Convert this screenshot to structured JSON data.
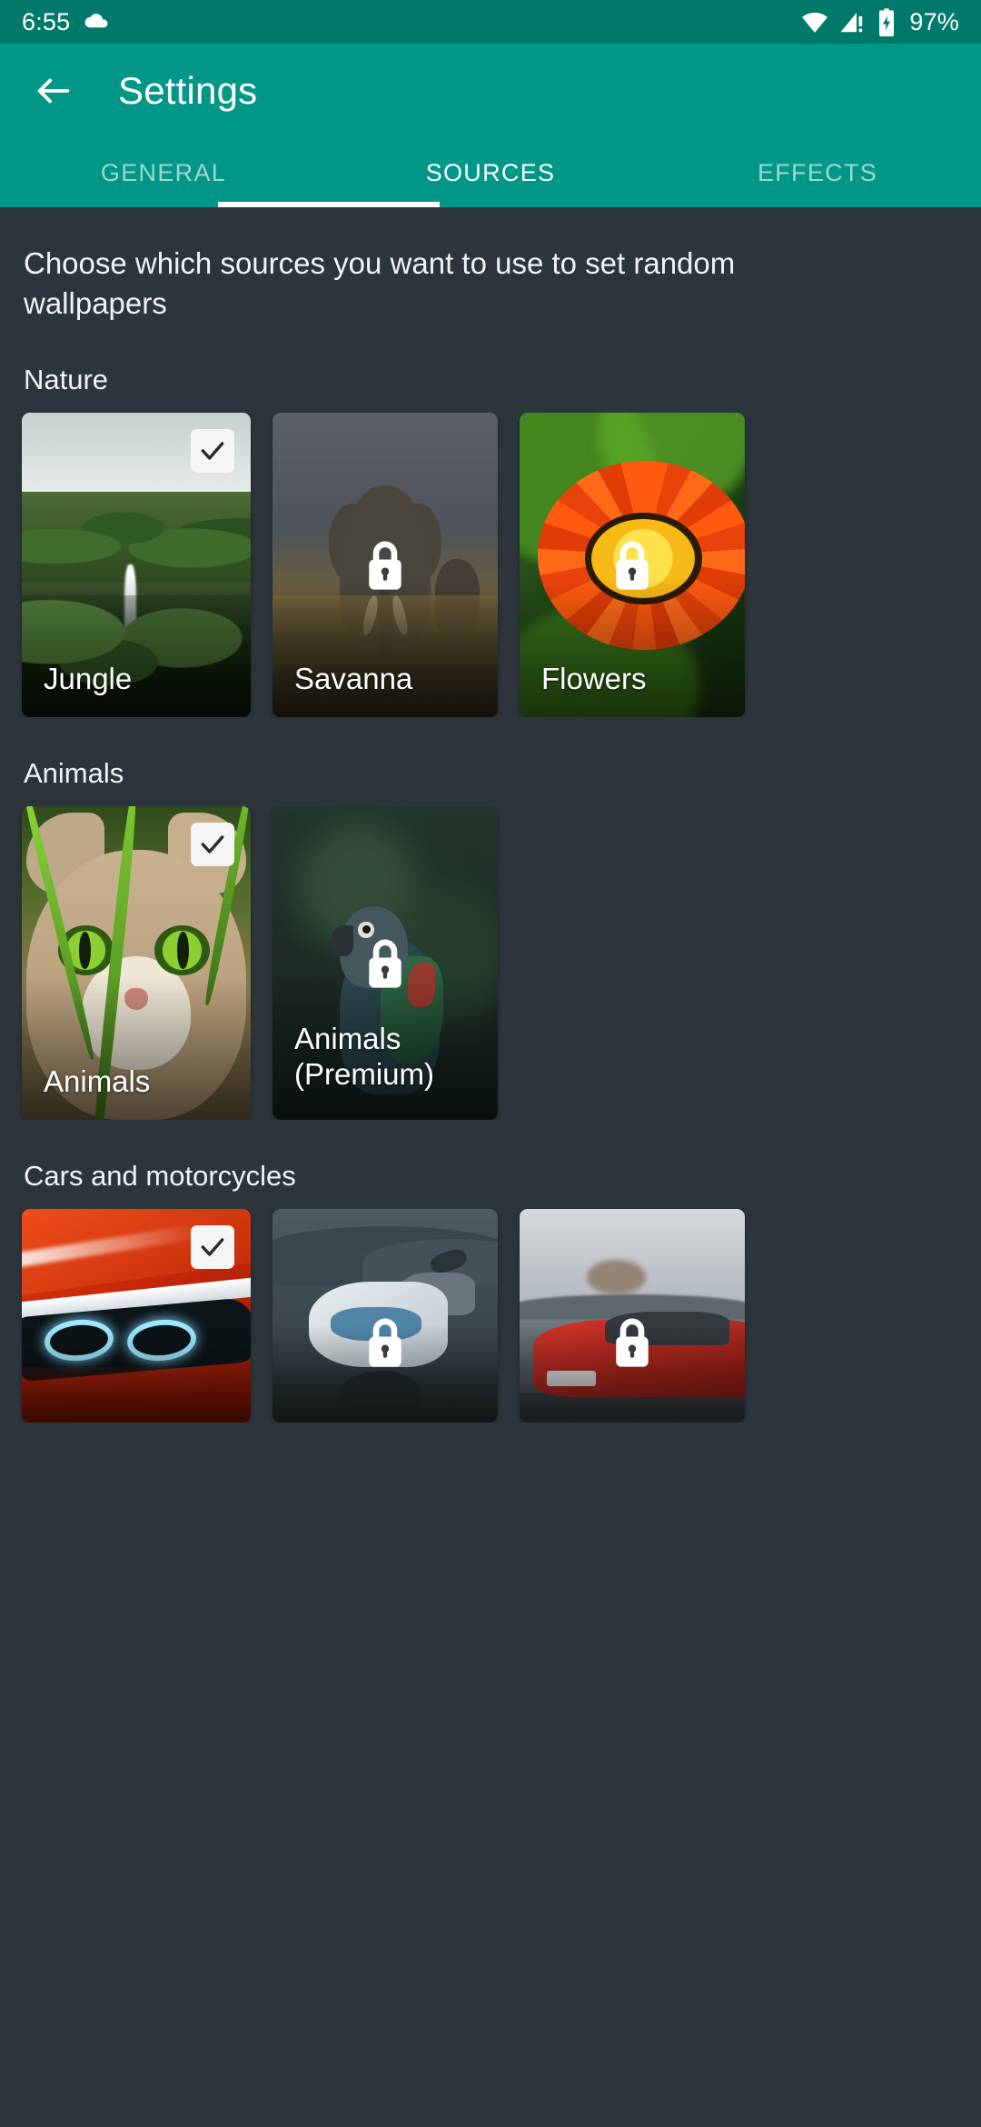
{
  "statusbar": {
    "time": "6:55",
    "battery_percent": "97%",
    "icons": [
      "cloud-icon",
      "wifi-icon",
      "cellular-signal-warning-icon",
      "battery-charging-icon"
    ]
  },
  "appbar": {
    "back_label": "←",
    "title": "Settings"
  },
  "tabs": [
    {
      "label": "GENERAL",
      "active": false
    },
    {
      "label": "SOURCES",
      "active": true
    },
    {
      "label": "EFFECTS",
      "active": false
    }
  ],
  "main": {
    "description": "Choose which sources you want to use to set random wallpapers",
    "sections": [
      {
        "title": "Nature",
        "cards": [
          {
            "label": "Jungle",
            "state": "checked",
            "art": "art-jungle"
          },
          {
            "label": "Savanna",
            "state": "locked",
            "art": "art-savanna"
          },
          {
            "label": "Flowers",
            "state": "locked",
            "art": "art-flowers"
          }
        ]
      },
      {
        "title": "Animals",
        "cards": [
          {
            "label": "Animals",
            "state": "checked",
            "art": "art-cat"
          },
          {
            "label": "Animals\n(Premium)",
            "state": "locked",
            "art": "art-parrot"
          }
        ]
      },
      {
        "title": "Cars and motorcycles",
        "cards": [
          {
            "label": "",
            "state": "checked",
            "art": "art-car"
          },
          {
            "label": "",
            "state": "locked",
            "art": "art-moto"
          },
          {
            "label": "",
            "state": "locked",
            "art": "art-sport"
          }
        ]
      }
    ]
  },
  "colors": {
    "statusbar_bg": "#00796B",
    "appbar_bg": "#009688",
    "body_bg": "#2C353B",
    "accent": "#FFFFFF",
    "text_primary": "#F1F3F4",
    "tab_inactive": "rgba(255,255,255,0.62)"
  }
}
